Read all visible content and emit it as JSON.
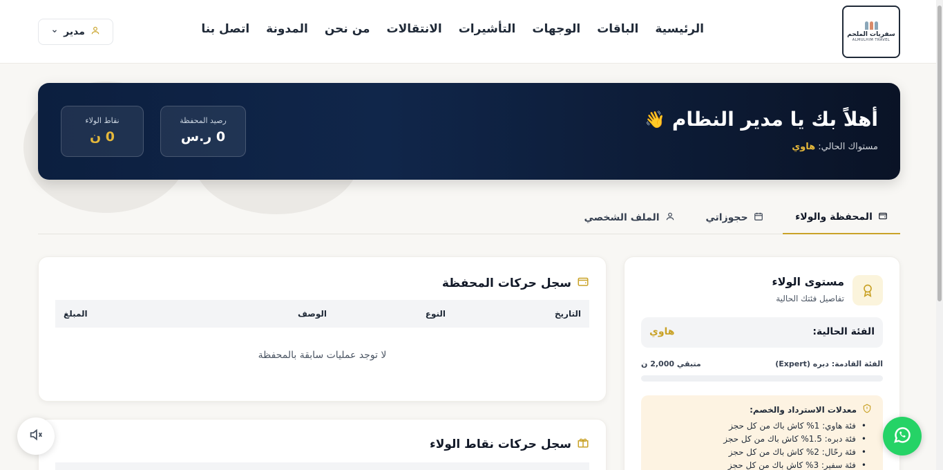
{
  "brand": {
    "logo_text": "سفريات الملحم",
    "logo_sub": "ALMULHIM TRAVEL"
  },
  "nav": {
    "items": [
      "الرئيسية",
      "الباقات",
      "الوجهات",
      "التأشيرات",
      "الانتقالات",
      "من نحن",
      "المدونة",
      "اتصل بنا"
    ]
  },
  "user_menu": {
    "label": "مدير"
  },
  "hero": {
    "greeting": "أهلاً بك يا مدير النظام",
    "wave": "👋",
    "level_prefix": "مستواك الحالي:",
    "level_value": "هاوي",
    "wallet_label": "رصيد المحفظة",
    "wallet_value": "0 ر.س",
    "points_label": "نقاط الولاء",
    "points_value": "0 ن"
  },
  "tabs": {
    "wallet": "المحفظة والولاء",
    "bookings": "حجوزاتي",
    "profile": "الملف الشخصي"
  },
  "wallet_history": {
    "title": "سجل حركات المحفظة",
    "columns": [
      "التاريخ",
      "النوع",
      "الوصف",
      "المبلغ"
    ],
    "empty": "لا توجد عمليات سابقة بالمحفظة"
  },
  "points_history": {
    "title": "سجل حركات نقاط الولاء"
  },
  "loyalty": {
    "title": "مستوى الولاء",
    "subtitle": "تفاصيل فئتك الحالية",
    "current_label": "الفئة الحالية:",
    "current_value": "هاوي",
    "next_label": "الفئة القادمة: دبره (Expert)",
    "remaining": "متبقي 2,000 ن",
    "progress_percent": 0,
    "rates_title": "معدلات الاسترداد والخصم:",
    "rates": [
      "فئة هاوي: 1% كاش باك من كل حجز",
      "فئة دبره: 1.5% كاش باك من كل حجز",
      "فئة رحّال: 2% كاش باك من كل حجز",
      "فئة سفير: 3% كاش باك من كل حجز"
    ]
  },
  "colors": {
    "accent_gold": "#c9a227",
    "hero_navy": "#0c1f3f",
    "whatsapp_green": "#25d366"
  },
  "icons": {
    "user": "user-icon",
    "wallet": "wallet-icon",
    "calendar": "calendar-icon",
    "gift": "gift-icon",
    "award": "award-icon",
    "shield": "shield-icon",
    "mute": "volume-mute-icon",
    "whatsapp": "whatsapp-icon"
  }
}
